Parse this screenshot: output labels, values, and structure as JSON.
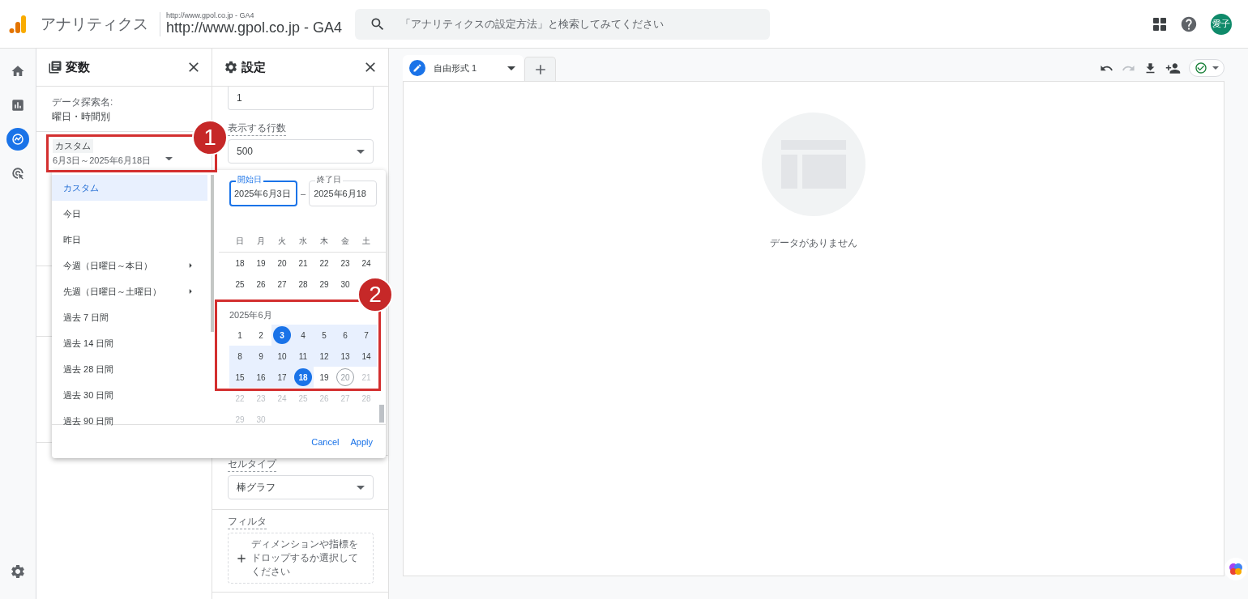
{
  "top_bar": {
    "product": "アナリティクス",
    "property_small": "http://www.gpol.co.jp - GA4",
    "property": "http://www.gpol.co.jp - GA4",
    "search_placeholder": "「アナリティクスの設定方法」と検索してみてください",
    "avatar": "愛子"
  },
  "nav": [
    {
      "kind": "home",
      "selected": false
    },
    {
      "kind": "reports",
      "selected": false
    },
    {
      "kind": "explore",
      "selected": true
    },
    {
      "kind": "advertising",
      "selected": false
    }
  ],
  "variables": {
    "title": "変数",
    "exploration_label": "データ探索名:",
    "exploration_name": "曜日・時間別",
    "date_chip": "カスタム",
    "date_range": "6月3日～2025年6月18日"
  },
  "settings": {
    "title": "設定",
    "field_value": "1",
    "rows_label": "表示する行数",
    "rows_value": "500",
    "cell_type_label": "セルタイプ",
    "cell_type_value": "棒グラフ",
    "filter_label": "フィルタ",
    "filter_placeholder": "ディメンションや指標をドロップするか選択してください"
  },
  "date_menu": {
    "presets": [
      {
        "label": "カスタム",
        "selected": true,
        "submenu": false
      },
      {
        "label": "今日",
        "selected": false,
        "submenu": false
      },
      {
        "label": "昨日",
        "selected": false,
        "submenu": false
      },
      {
        "label": "今週（日曜日～本日）",
        "selected": false,
        "submenu": true
      },
      {
        "label": "先週（日曜日～土曜日）",
        "selected": false,
        "submenu": true
      },
      {
        "label": "過去 7 日間",
        "selected": false,
        "submenu": false
      },
      {
        "label": "過去 14 日間",
        "selected": false,
        "submenu": false
      },
      {
        "label": "過去 28 日間",
        "selected": false,
        "submenu": false
      },
      {
        "label": "過去 30 日間",
        "selected": false,
        "submenu": false
      },
      {
        "label": "過去 90 日間",
        "selected": false,
        "submenu": false
      }
    ],
    "start_label": "開始日",
    "start_value": "2025年6月3日",
    "range_separator": "–",
    "end_label": "終了日",
    "end_value": "2025年6月18",
    "weekdays": [
      "日",
      "月",
      "火",
      "水",
      "木",
      "金",
      "土"
    ],
    "months": [
      {
        "weeks": [
          [
            {
              "label": "18",
              "kind": "past"
            },
            {
              "label": "19",
              "kind": "past"
            },
            {
              "label": "20",
              "kind": "past"
            },
            {
              "label": "21",
              "kind": "past"
            },
            {
              "label": "22",
              "kind": "past"
            },
            {
              "label": "23",
              "kind": "past"
            },
            {
              "label": "24",
              "kind": "past"
            }
          ],
          [
            {
              "label": "25",
              "kind": "past"
            },
            {
              "label": "26",
              "kind": "past"
            },
            {
              "label": "27",
              "kind": "past"
            },
            {
              "label": "28",
              "kind": "past"
            },
            {
              "label": "29",
              "kind": "past"
            },
            {
              "label": "30",
              "kind": "past"
            }
          ]
        ]
      },
      {
        "title": "2025年6月",
        "weeks": [
          [
            {
              "label": "1",
              "kind": "past"
            },
            {
              "label": "2",
              "kind": "past"
            },
            {
              "label": "3",
              "kind": "start"
            },
            {
              "label": "4",
              "kind": "range"
            },
            {
              "label": "5",
              "kind": "range"
            },
            {
              "label": "6",
              "kind": "range"
            },
            {
              "label": "7",
              "kind": "range"
            }
          ],
          [
            {
              "label": "8",
              "kind": "range"
            },
            {
              "label": "9",
              "kind": "range"
            },
            {
              "label": "10",
              "kind": "range"
            },
            {
              "label": "11",
              "kind": "range"
            },
            {
              "label": "12",
              "kind": "range"
            },
            {
              "label": "13",
              "kind": "range"
            },
            {
              "label": "14",
              "kind": "range"
            }
          ],
          [
            {
              "label": "15",
              "kind": "range"
            },
            {
              "label": "16",
              "kind": "range"
            },
            {
              "label": "17",
              "kind": "range"
            },
            {
              "label": "18",
              "kind": "end"
            },
            {
              "label": "19",
              "kind": "past"
            },
            {
              "label": "20",
              "kind": "today"
            },
            {
              "label": "21",
              "kind": "future"
            }
          ],
          [
            {
              "label": "22",
              "kind": "future"
            },
            {
              "label": "23",
              "kind": "future"
            },
            {
              "label": "24",
              "kind": "future"
            },
            {
              "label": "25",
              "kind": "future"
            },
            {
              "label": "26",
              "kind": "future"
            },
            {
              "label": "27",
              "kind": "future"
            },
            {
              "label": "28",
              "kind": "future"
            }
          ],
          [
            {
              "label": "29",
              "kind": "future"
            },
            {
              "label": "30",
              "kind": "future"
            }
          ]
        ]
      }
    ],
    "cancel": "Cancel",
    "apply": "Apply"
  },
  "canvas": {
    "tabs": [
      {
        "label": "自由形式 1",
        "selected": true
      }
    ],
    "empty_text": "データがありません"
  },
  "annotations": [
    {
      "label": "1"
    },
    {
      "label": "2"
    }
  ]
}
